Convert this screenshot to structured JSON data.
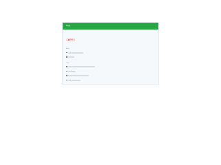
{
  "theme": {
    "accent": "#28a745",
    "chip_bg": "#fde7e8",
    "chip_fg": "#d34f5b"
  },
  "header": {
    "title": "Page"
  },
  "chip": {
    "label": "Alert"
  },
  "sections": [
    {
      "label": "Alerts",
      "items": [
        {
          "icon": "list-icon",
          "text": ""
        },
        {
          "icon": "list-icon",
          "text": ""
        }
      ]
    },
    {
      "label": "Other",
      "items": [
        {
          "icon": "list-icon",
          "text": ""
        },
        {
          "icon": "list-icon",
          "text": ""
        },
        {
          "icon": "list-icon",
          "text": ""
        },
        {
          "icon": "list-icon",
          "text": ""
        }
      ]
    }
  ]
}
